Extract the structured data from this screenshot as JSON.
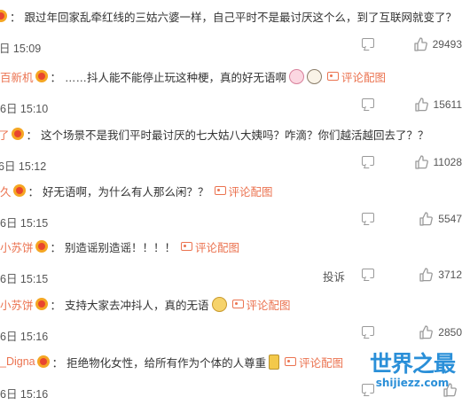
{
  "comments": [
    {
      "username": "",
      "text": "跟过年回家乱牵红线的三姑六婆一样，自己平时不是最讨厌这个么，到了互联网就变了？",
      "emojis": [],
      "pic_link": "",
      "time": "6日 15:09",
      "likes": "29493",
      "show_report": false
    },
    {
      "username": "百新机",
      "text": "……抖人能不能停止玩这种梗，真的好无语啊",
      "emojis": [
        "sad-face",
        "shocked-face"
      ],
      "pic_link": "评论配图",
      "time": "6日 15:10",
      "likes": "15611",
      "show_report": false
    },
    {
      "username": "了",
      "text": "这个场景不是我们平时最讨厌的七大姑八大姨吗？咋滴？你们越活越回去了？？",
      "emojis": [],
      "pic_link": "",
      "time": "6日 15:12",
      "likes": "11028",
      "show_report": false
    },
    {
      "username": "久",
      "text": "好无语啊，为什么有人那么闲？？",
      "emojis": [],
      "pic_link": "评论配图",
      "time": "6日 15:15",
      "likes": "5547",
      "show_report": false
    },
    {
      "username": "小苏饼",
      "text": "别造谣别造谣！！！！",
      "emojis": [],
      "pic_link": "评论配图",
      "time": "6日 15:15",
      "likes": "3712",
      "show_report": true,
      "report_label": "投诉"
    },
    {
      "username": "小苏饼",
      "text": "支持大家去冲抖人，真的无语",
      "emojis": [
        "speechless-face"
      ],
      "pic_link": "评论配图",
      "time": "6日 15:16",
      "likes": "2850",
      "show_report": false
    },
    {
      "username": "_Digna",
      "text": "拒绝物化女性，给所有作为个体的人尊重",
      "emojis": [
        "candle"
      ],
      "pic_link": "评论配图",
      "time": "6日 15:16",
      "likes": "",
      "show_report": false
    }
  ],
  "watermark": {
    "title": "世界之最",
    "url": "shijiezz.com"
  },
  "colors": {
    "username": "#eb7350",
    "link": "#eb7350",
    "watermark": "#2a8fd8",
    "icon": "#999999"
  }
}
